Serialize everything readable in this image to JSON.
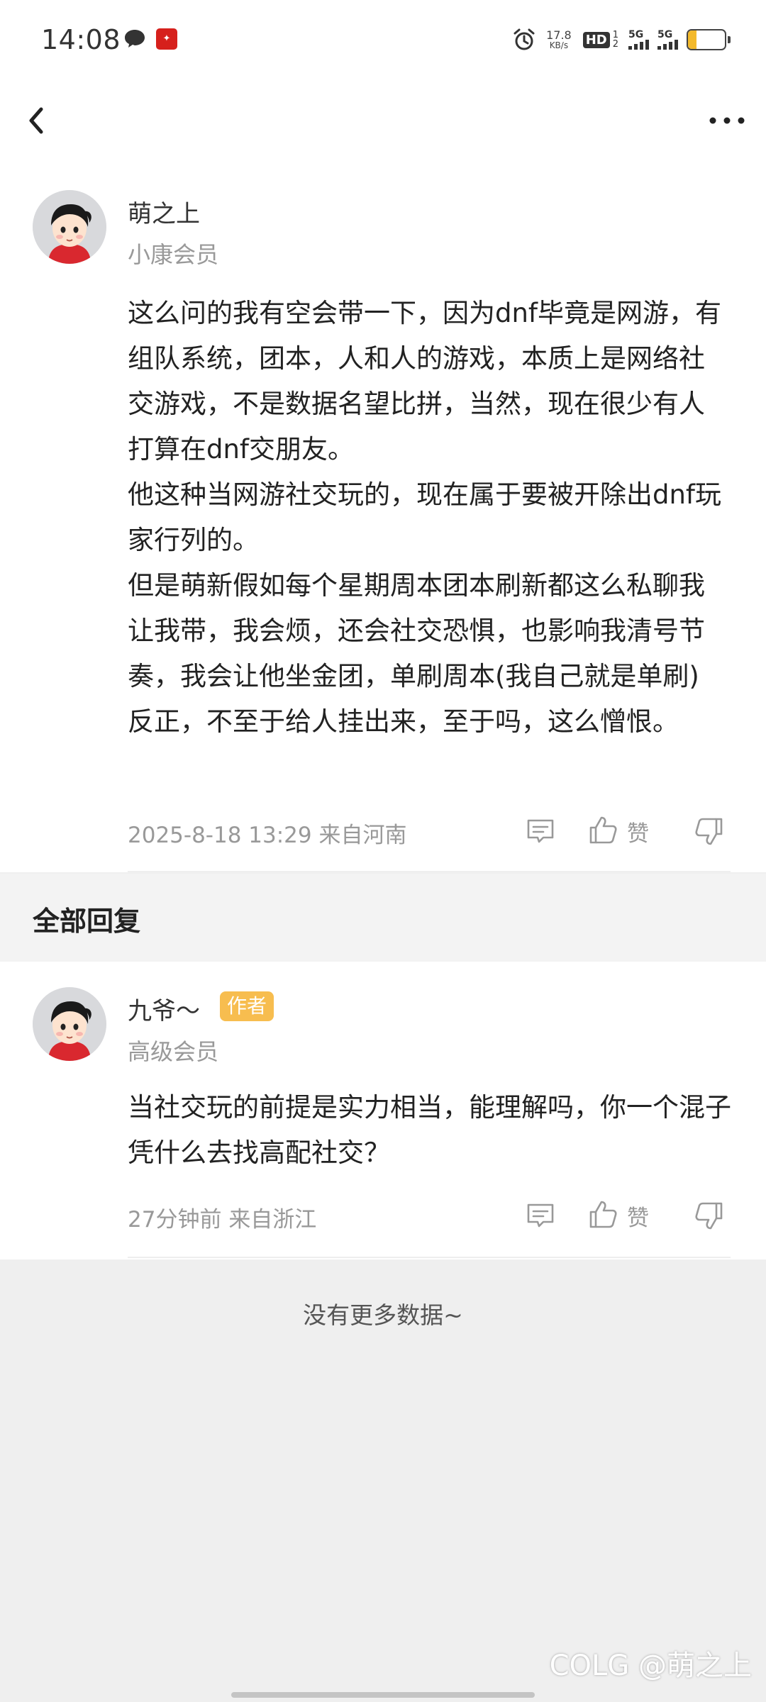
{
  "status_bar": {
    "time": "14:08",
    "net_speed_value": "17.8",
    "net_speed_unit": "KB/s",
    "hd_label": "HD",
    "hd_sub_top": "1",
    "hd_sub_bottom": "2",
    "sim1_label": "5G",
    "sim2_label": "5G",
    "battery_level": "24",
    "battery_color": "#f3b92b"
  },
  "nav": {
    "back_icon": "chevron-left-icon",
    "more_icon": "more-dots-icon"
  },
  "post": {
    "username": "萌之上",
    "level": "小康会员",
    "paragraphs": [
      "这么问的我有空会带一下，因为dnf毕竟是网游，有组队系统，团本，人和人的游戏，本质上是网络社交游戏，不是数据名望比拼，当然，现在很少有人打算在dnf交朋友。",
      "他这种当网游社交玩的，现在属于要被开除出dnf玩家行列的。",
      "但是萌新假如每个星期周本团本刷新都这么私聊我让我带，我会烦，还会社交恐惧，也影响我清号节奏，我会让他坐金团，单刷周本(我自己就是单刷)",
      "反正，不至于给人挂出来，至于吗，这么憎恨。"
    ],
    "datetime": "2025-8-18 13:29",
    "location": "来自河南",
    "like_label": "赞"
  },
  "replies_section": {
    "title": "全部回复"
  },
  "reply": {
    "username": "九爷～",
    "badge": "作者",
    "badge_color": "#f7bd4f",
    "level": "高级会员",
    "content": "当社交玩的前提是实力相当，能理解吗，你一个混子凭什么去找高配社交？",
    "time": "27分钟前",
    "location": "来自浙江",
    "like_label": "赞"
  },
  "footer": {
    "no_more": "没有更多数据~",
    "watermark": "COLG @萌之上"
  }
}
